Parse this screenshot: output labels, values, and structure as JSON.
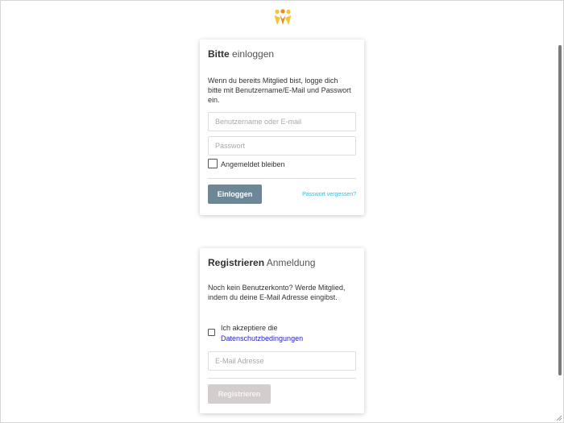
{
  "brand": {
    "logo_icon": "people-logo-icon",
    "colors": {
      "orange": "#f08a1e",
      "yellow": "#f5c23a"
    }
  },
  "login": {
    "title_strong": "Bitte",
    "title_light": "einloggen",
    "description": "Wenn du bereits Mitglied bist, logge dich bitte mit Benutzername/E-Mail und Passwort ein.",
    "username_placeholder": "Benutzername oder E-mail",
    "password_placeholder": "Passwort",
    "remember_label": "Angemeldet bleiben",
    "submit_label": "Einloggen",
    "forgot_link": "Passwort vergessen?",
    "button_color": "#6e8797",
    "link_color": "#40b8d2"
  },
  "register": {
    "title_strong": "Registrieren",
    "title_light": "Anmeldung",
    "description": "Noch kein Benutzerkonto? Werde Mitglied, indem du deine E-Mail Adresse eingibst.",
    "accept_prefix": "Ich akzeptiere die",
    "privacy_link": "Datenschutzbedingungen",
    "email_placeholder": "E-Mail Adresse",
    "submit_label": "Registrieren",
    "button_color_disabled": "#d3cdcd",
    "link_color": "#2323c8"
  }
}
